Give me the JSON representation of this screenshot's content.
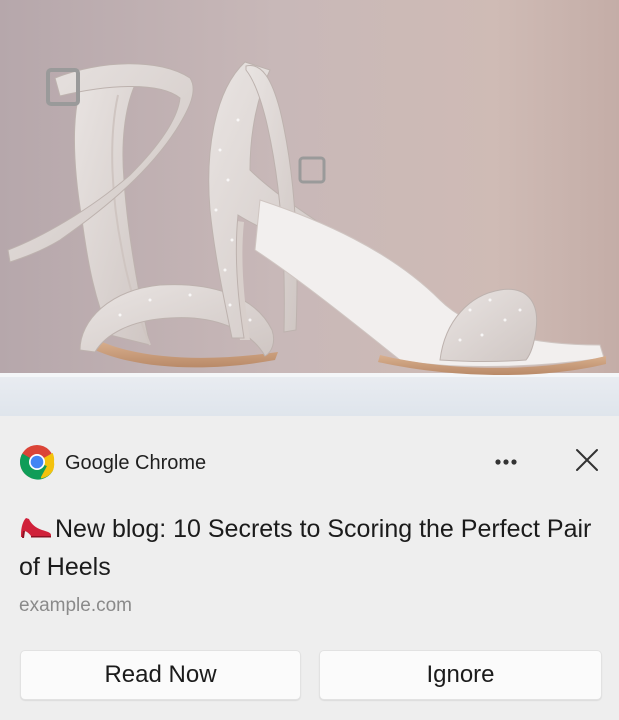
{
  "hero_image": {
    "description_icon": "white-high-heel-sandals-photo"
  },
  "header": {
    "app_name": "Google Chrome",
    "app_icon": "chrome-logo-icon",
    "more_icon": "more-options-icon",
    "close_icon": "close-icon"
  },
  "notification": {
    "title_emoji_icon": "high-heel-shoe-icon",
    "title": "New blog: 10 Secrets to Scoring the Perfect Pair of Heels",
    "source": "example.com"
  },
  "actions": {
    "primary_label": "Read Now",
    "secondary_label": "Ignore"
  },
  "colors": {
    "background": "#eeeeee",
    "button_background": "#fbfbfb",
    "source_text": "#8a8a8a",
    "chrome_red": "#db4437",
    "chrome_yellow": "#f4c20d",
    "chrome_green": "#0f9d58",
    "chrome_blue": "#4285f4"
  }
}
